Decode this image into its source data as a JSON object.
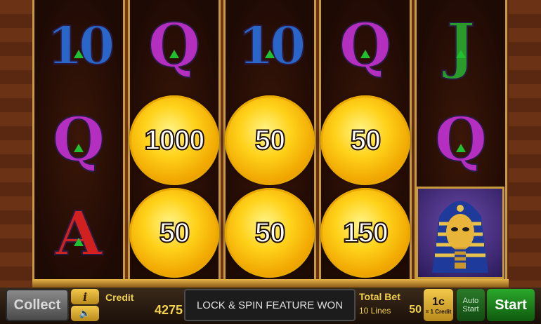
{
  "reels": [
    [
      "10",
      "Q",
      "A"
    ],
    [
      "Q",
      "coin",
      "coin"
    ],
    [
      "10",
      "coin",
      "coin"
    ],
    [
      "Q",
      "coin",
      "coin"
    ],
    [
      "J",
      "Q",
      "pharaoh"
    ]
  ],
  "coins": {
    "r1c1": "1000",
    "r1c2": "50",
    "r1c3": "50",
    "r2c1": "50",
    "r2c2": "50",
    "r2c3": "150"
  },
  "symbols": {
    "ten": "10",
    "q": "Q",
    "j": "J",
    "a": "A"
  },
  "bar": {
    "collect_label": "Collect",
    "info_label": "i",
    "credit_label": "Credit",
    "credit_value": "4275",
    "message": "LOCK & SPIN FEATURE WON",
    "total_bet_label": "Total Bet",
    "lines_label": "10 Lines",
    "total_bet_value": "50",
    "denom_value": "1c",
    "denom_sub": "= 1 Credit",
    "auto_label": "Auto",
    "auto_sub": "Start",
    "start_label": "Start"
  },
  "colors": {
    "credit_text": "#f2d04a",
    "start_green": "#2aa82a",
    "coin_gold": "#ffd21a"
  }
}
